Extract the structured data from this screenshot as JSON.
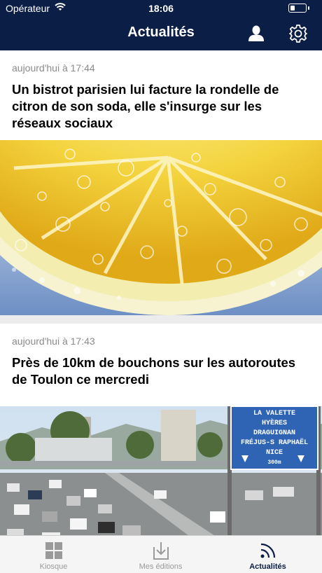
{
  "status_bar": {
    "carrier": "Opérateur",
    "time": "18:06"
  },
  "nav": {
    "title": "Actualités"
  },
  "articles": [
    {
      "date": "aujourd'hui à 17:44",
      "title": "Un bistrot parisien lui facture la rondelle de citron de son soda, elle s'insurge sur les réseaux sociaux"
    },
    {
      "date": "aujourd'hui à 17:43",
      "title": "Près de 10km de bouchons sur les autoroutes de Toulon ce mercredi",
      "sign_lines": [
        "LA VALETTE",
        "HYÈRES",
        "DRAGUIGNAN",
        "FRÉJUS-S RAPHAËL",
        "NICE",
        "300m"
      ]
    }
  ],
  "tabs": [
    {
      "label": "Kiosque",
      "icon": "grid-icon"
    },
    {
      "label": "Mes éditions",
      "icon": "download-icon"
    },
    {
      "label": "Actualités",
      "icon": "rss-icon"
    }
  ],
  "colors": {
    "header": "#0b1e45",
    "active_tab": "#0b1e45",
    "inactive_tab": "#9a9a9a"
  }
}
